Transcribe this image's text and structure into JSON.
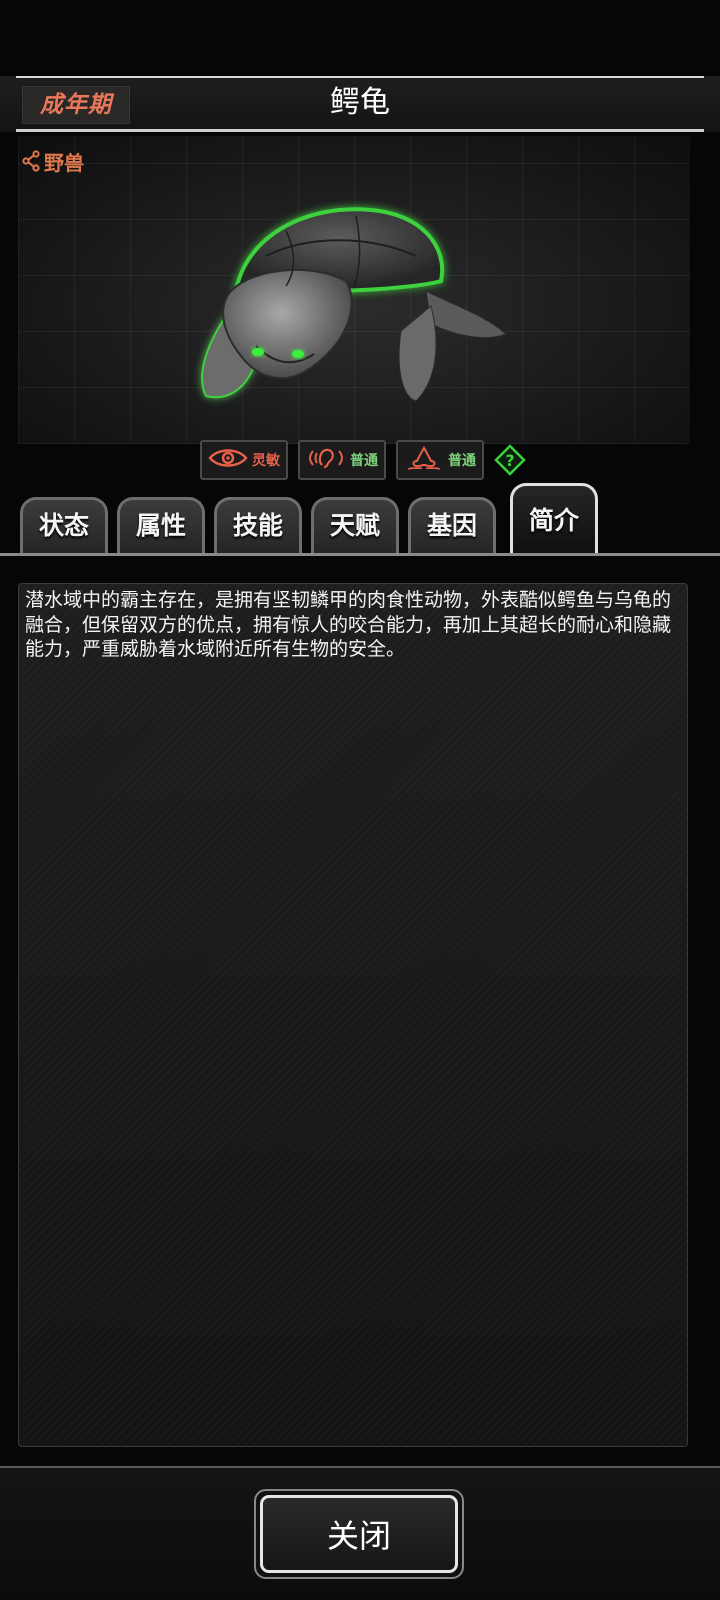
{
  "header": {
    "stage_label": "成年期",
    "title": "鳄龟"
  },
  "creature": {
    "category_label": "野兽",
    "category_icon": "share-icon",
    "glow_color": "#3cd23c",
    "traits": [
      {
        "icon": "eye-icon",
        "label": "灵敏",
        "color": "#e8604a"
      },
      {
        "icon": "ear-icon",
        "label": "普通",
        "color": "#7fd07a"
      },
      {
        "icon": "nose-icon",
        "label": "普通",
        "color": "#7fd07a"
      }
    ],
    "help_icon": "help-icon"
  },
  "tabs": [
    {
      "label": "状态",
      "active": false
    },
    {
      "label": "属性",
      "active": false
    },
    {
      "label": "技能",
      "active": false
    },
    {
      "label": "天赋",
      "active": false
    },
    {
      "label": "基因",
      "active": false
    },
    {
      "label": "简介",
      "active": true
    }
  ],
  "description": {
    "text": "潜水域中的霸主存在，是拥有坚韧鳞甲的肉食性动物，外表酷似鳄鱼与乌龟的融合，但保留双方的优点，拥有惊人的咬合能力，再加上其超长的耐心和隐藏能力，严重威胁着水域附近所有生物的安全。"
  },
  "footer": {
    "close_label": "关闭"
  },
  "colors": {
    "accent_orange": "#e0784e",
    "trait_red": "#e8604a",
    "trait_green": "#7fd07a",
    "help_green": "#3cd23c"
  }
}
